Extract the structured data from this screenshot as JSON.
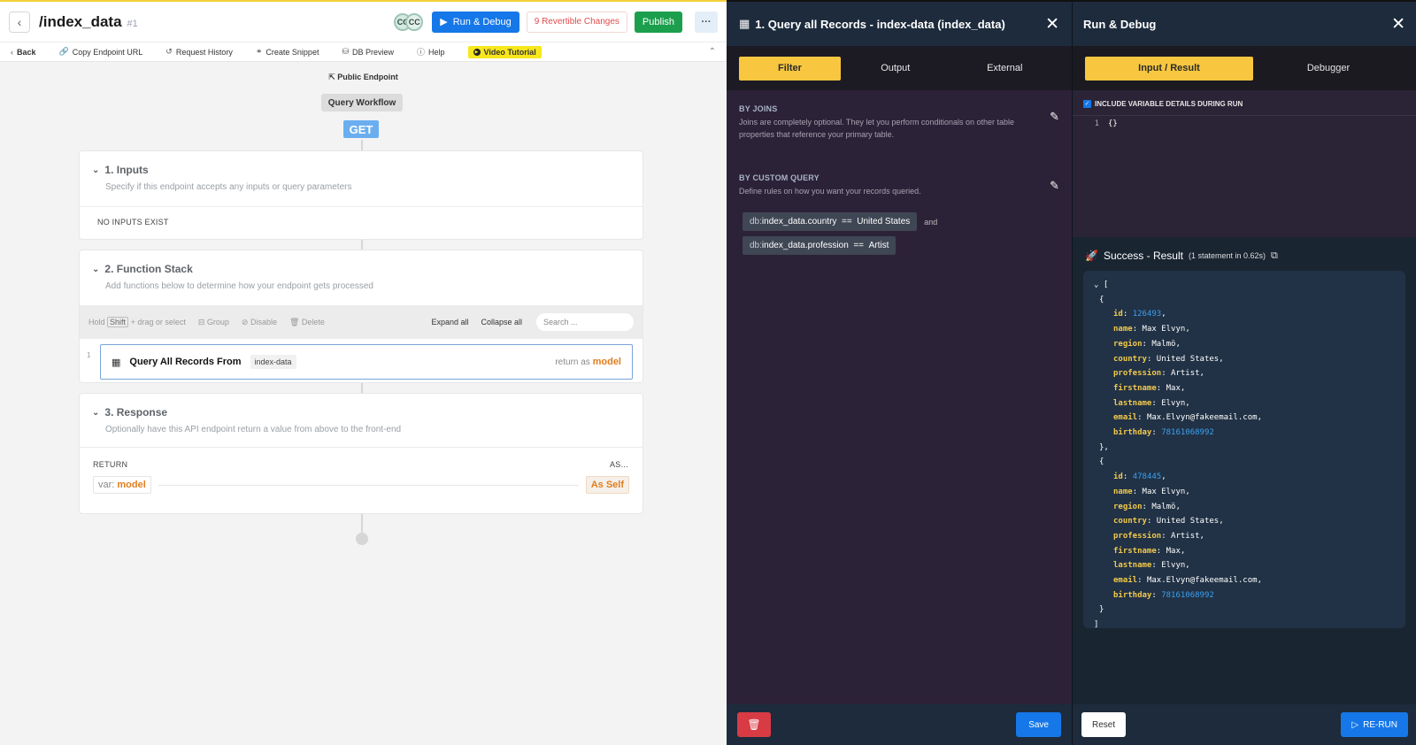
{
  "left": {
    "title": "/index_data",
    "title_hash": "#1",
    "avatars": [
      "CC",
      "CC"
    ],
    "run_debug": "Run & Debug",
    "revertible": "9 Revertible Changes",
    "publish": "Publish",
    "more": "···",
    "toolbar": {
      "back": "Back",
      "copy_url": "Copy Endpoint URL",
      "history": "Request History",
      "snippet": "Create Snippet",
      "db_preview": "DB Preview",
      "help": "Help",
      "video": "Video Tutorial"
    },
    "public_endpoint": "Public Endpoint",
    "query_workflow": "Query Workflow",
    "method": "GET",
    "inputs": {
      "title": "1. Inputs",
      "subtitle": "Specify if this endpoint accepts any inputs or query parameters",
      "empty": "NO INPUTS EXIST"
    },
    "function_stack": {
      "title": "2. Function Stack",
      "subtitle": "Add functions below to determine how your endpoint gets processed",
      "hold": "Hold",
      "shift": "Shift",
      "drag": "+ drag or select",
      "group": "Group",
      "disable": "Disable",
      "delete": "Delete",
      "expand_all": "Expand all",
      "collapse_all": "Collapse all",
      "search_placeholder": "Search ...",
      "row_number": "1",
      "step_title": "Query All Records From",
      "step_table": "index-data",
      "return_as": "return as",
      "return_var": "model"
    },
    "response": {
      "title": "3. Response",
      "subtitle": "Optionally have this API endpoint return a value from above to the front-end",
      "return_label": "RETURN",
      "as_label": "AS...",
      "var_prefix": "var:",
      "var_name": "model",
      "as_self": "As Self"
    }
  },
  "middle": {
    "title": "1. Query all Records - index-data (index_data)",
    "tabs": [
      "Filter",
      "Output",
      "External"
    ],
    "by_joins": {
      "title": "BY JOINS",
      "desc": "Joins are completely optional. They let you perform conditionals on other table properties that reference your primary table."
    },
    "by_custom_query": {
      "title": "BY CUSTOM QUERY",
      "desc": "Define rules on how you want your records queried."
    },
    "conditions": [
      {
        "prefix": "db:",
        "field": "index_data.country",
        "op": "==",
        "value": "United States",
        "joiner": "and"
      },
      {
        "prefix": "db:",
        "field": "index_data.profession",
        "op": "==",
        "value": "Artist",
        "joiner": ""
      }
    ],
    "save": "Save"
  },
  "right": {
    "title": "Run & Debug",
    "tabs": [
      "Input / Result",
      "Debugger"
    ],
    "include_vars": "INCLUDE VARIABLE DETAILS DURING RUN",
    "editor_line": "1",
    "editor_text": "{}",
    "result_title": "Success - Result",
    "result_meta": "(1 statement in 0.62s)",
    "records": [
      {
        "id": "126493",
        "name": "Max Elvyn",
        "region": "Malmö",
        "country": "United States",
        "profession": "Artist",
        "firstname": "Max",
        "lastname": "Elvyn",
        "email": "Max.Elvyn@fakeemail.com",
        "birthday": "78161068992"
      },
      {
        "id": "478445",
        "name": "Max Elvyn",
        "region": "Malmö",
        "country": "United States",
        "profession": "Artist",
        "firstname": "Max",
        "lastname": "Elvyn",
        "email": "Max.Elvyn@fakeemail.com",
        "birthday": "78161068992"
      }
    ],
    "reset": "Reset",
    "rerun": "RE-RUN"
  },
  "colors": {
    "accent_yellow": "#f8c73f",
    "primary_blue": "#1677e8",
    "publish_green": "#1c9f4d",
    "danger_red": "#d93b45",
    "orange_var": "#e17e1e"
  }
}
